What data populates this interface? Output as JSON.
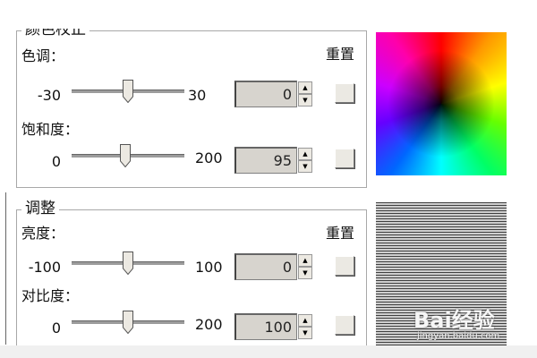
{
  "color_group": {
    "title": "颜色校正",
    "reset_label": "重置",
    "hue": {
      "label": "色调：",
      "min": "-30",
      "max": "30",
      "value": "0",
      "fraction": 0.5
    },
    "saturation": {
      "label": "饱和度：",
      "min": "0",
      "max": "200",
      "value": "95",
      "fraction": 0.475
    }
  },
  "adjust_group": {
    "title": "调整",
    "reset_label": "重置",
    "brightness": {
      "label": "亮度：",
      "min": "-100",
      "max": "100",
      "value": "0",
      "fraction": 0.5
    },
    "contrast": {
      "label": "对比度：",
      "min": "0",
      "max": "200",
      "value": "100",
      "fraction": 0.5
    }
  },
  "watermark": {
    "main": "Bai经验",
    "sub": "jingyan.baidu.com"
  }
}
